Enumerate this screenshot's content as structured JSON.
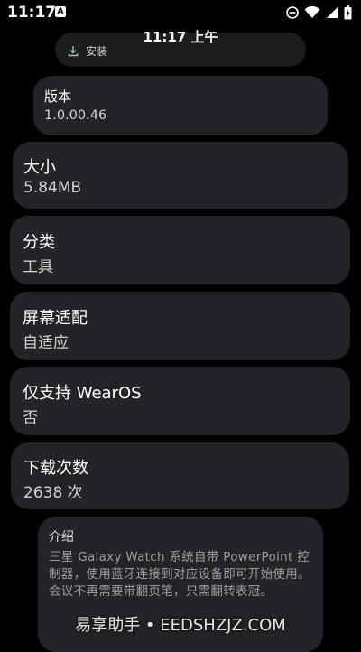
{
  "status_bar": {
    "time": "11:17",
    "notification_icon": "A",
    "icons": [
      "do-not-disturb-icon",
      "wifi-icon",
      "signal-icon",
      "battery-icon"
    ]
  },
  "watch": {
    "time": "11:17 上午",
    "install_label": "安装"
  },
  "info": {
    "version": {
      "label": "版本",
      "value": "1.0.00.46"
    },
    "size": {
      "label": "大小",
      "value": "5.84MB"
    },
    "category": {
      "label": "分类",
      "value": "工具"
    },
    "screen": {
      "label": "屏幕适配",
      "value": "自适应"
    },
    "wearos": {
      "label": "仅支持 WearOS",
      "value": "否"
    },
    "downloads": {
      "label": "下载次数",
      "value": "2638 次"
    }
  },
  "intro": {
    "title": "介绍",
    "body": "三星 Galaxy Watch 系统自带 PowerPoint 控制器，使用蓝牙连接到对应设备即可开始使用。会议不再需要带翻页笔，只需翻转表冠。"
  },
  "watermark": "易享助手 • EEDSHZJZ.COM"
}
